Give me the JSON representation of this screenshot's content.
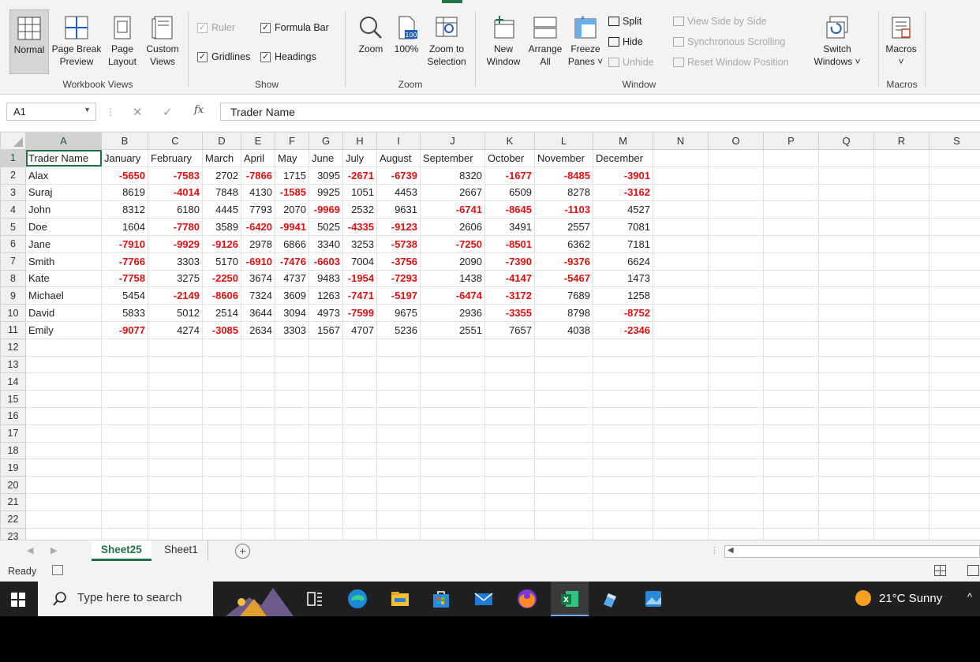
{
  "ribbon": {
    "groups": {
      "workbook_views": "Workbook Views",
      "show": "Show",
      "zoom": "Zoom",
      "window": "Window",
      "macros": "Macros"
    },
    "normal": "Normal",
    "page_break_preview": [
      "Page Break",
      "Preview"
    ],
    "page_layout": [
      "Page",
      "Layout"
    ],
    "custom_views": [
      "Custom",
      "Views"
    ],
    "ruler": "Ruler",
    "formula_bar": "Formula Bar",
    "gridlines": "Gridlines",
    "headings": "Headings",
    "zoom": "Zoom",
    "zoom_100": "100%",
    "zoom_to_selection": [
      "Zoom to",
      "Selection"
    ],
    "new_window": [
      "New",
      "Window"
    ],
    "arrange_all": [
      "Arrange",
      "All"
    ],
    "freeze_panes": [
      "Freeze",
      "Panes ˅"
    ],
    "split": "Split",
    "hide": "Hide",
    "unhide": "Unhide",
    "view_side_by_side": "View Side by Side",
    "synchronous_scrolling": "Synchronous Scrolling",
    "reset_window_position": "Reset Window Position",
    "switch_windows": [
      "Switch",
      "Windows ˅"
    ],
    "macros": [
      "Macros",
      "˅"
    ]
  },
  "formula_bar": {
    "cell_ref": "A1",
    "content": "Trader Name",
    "fx": "fx"
  },
  "columns": [
    "A",
    "B",
    "C",
    "D",
    "E",
    "F",
    "G",
    "H",
    "I",
    "J",
    "K",
    "L",
    "M",
    "N",
    "O",
    "P",
    "Q",
    "R",
    "S"
  ],
  "header_row": [
    "Trader Name",
    "January",
    "February",
    "March",
    "April",
    "May",
    "June",
    "July",
    "August",
    "September",
    "October",
    "November",
    "December"
  ],
  "rows": [
    {
      "name": "Alax",
      "values": [
        -5650,
        -7583,
        2702,
        -7866,
        1715,
        3095,
        -2671,
        -6739,
        8320,
        -1677,
        -8485,
        -3901
      ]
    },
    {
      "name": "Suraj",
      "values": [
        8619,
        -4014,
        7848,
        4130,
        -1585,
        9925,
        1051,
        4453,
        2667,
        6509,
        8278,
        -3162
      ]
    },
    {
      "name": "John",
      "values": [
        8312,
        6180,
        4445,
        7793,
        2070,
        -9969,
        2532,
        9631,
        -6741,
        -8645,
        -1103,
        4527
      ]
    },
    {
      "name": "Doe",
      "values": [
        1604,
        -7780,
        3589,
        -6420,
        -9941,
        5025,
        -4335,
        -9123,
        2606,
        3491,
        2557,
        7081
      ]
    },
    {
      "name": "Jane",
      "values": [
        -7910,
        -9929,
        -9126,
        2978,
        6866,
        3340,
        3253,
        -5738,
        -7250,
        -8501,
        6362,
        7181
      ]
    },
    {
      "name": "Smith",
      "values": [
        -7766,
        3303,
        5170,
        -6910,
        -7476,
        -6603,
        7004,
        -3756,
        2090,
        -7390,
        -9376,
        6624
      ]
    },
    {
      "name": "Kate",
      "values": [
        -7758,
        3275,
        -2250,
        3674,
        4737,
        9483,
        -1954,
        -7293,
        1438,
        -4147,
        -5467,
        1473
      ]
    },
    {
      "name": "Michael",
      "values": [
        5454,
        -2149,
        -8606,
        7324,
        3609,
        1263,
        -7471,
        -5197,
        -6474,
        -3172,
        7689,
        1258
      ]
    },
    {
      "name": "David",
      "values": [
        5833,
        5012,
        2514,
        3644,
        3094,
        4973,
        -7599,
        9675,
        2936,
        -3355,
        8798,
        -8752
      ]
    },
    {
      "name": "Emily",
      "values": [
        -9077,
        4274,
        -3085,
        2634,
        3303,
        1567,
        4707,
        5236,
        2551,
        7657,
        4038,
        -2346
      ]
    }
  ],
  "row_numbers": [
    1,
    2,
    3,
    4,
    5,
    6,
    7,
    8,
    9,
    10,
    11,
    12,
    13,
    14,
    15,
    16,
    17,
    18,
    19,
    20,
    21,
    22,
    23
  ],
  "sheets": [
    "Sheet25",
    "Sheet1"
  ],
  "active_sheet": "Sheet25",
  "status": {
    "ready": "Ready"
  },
  "taskbar": {
    "search_placeholder": "Type here to search",
    "weather": "21°C  Sunny"
  },
  "colors": {
    "accent": "#217346",
    "negative": "#e01010"
  }
}
